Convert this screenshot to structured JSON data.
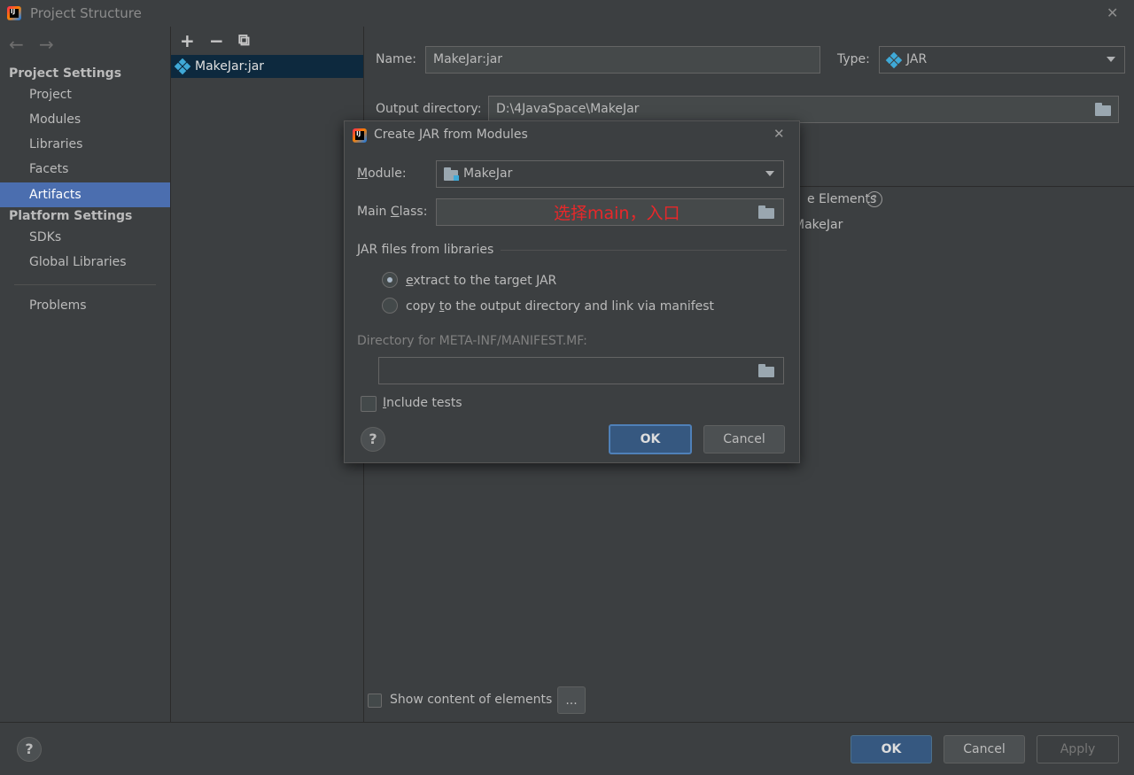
{
  "window": {
    "title": "Project Structure",
    "app_icon_text": "IJ",
    "close_glyph": "✕",
    "back_glyph": "←",
    "forward_glyph": "→"
  },
  "sidebar": {
    "project_settings_header": "Project Settings",
    "project_items": [
      {
        "label": "Project"
      },
      {
        "label": "Modules"
      },
      {
        "label": "Libraries"
      },
      {
        "label": "Facets"
      },
      {
        "label": "Artifacts",
        "selected": true
      }
    ],
    "platform_settings_header": "Platform Settings",
    "platform_items": [
      {
        "label": "SDKs"
      },
      {
        "label": "Global Libraries"
      }
    ],
    "problems_label": "Problems"
  },
  "artifacts_list": {
    "add_glyph": "+",
    "remove_glyph": "−",
    "copy_glyph": "⧉",
    "items": [
      {
        "label": "MakeJar:jar"
      }
    ]
  },
  "artifact_editor": {
    "name_label": "Name:",
    "name_value": "MakeJar:jar",
    "type_label": "Type:",
    "type_value": "JAR",
    "output_dir_label": "Output directory:",
    "output_dir_value": "D:\\4JavaSpace\\MakeJar",
    "available_elements_partial": "e Elements",
    "module_tree_partial": "MakeJar",
    "show_content_label": "Show content of elements",
    "ellipsis_button": "..."
  },
  "dialog": {
    "title": "Create JAR from Modules",
    "close_glyph": "✕",
    "module_label_u": "M",
    "module_label_rest": "odule:",
    "module_value": "MakeJar",
    "main_class_label_pre": "Main ",
    "main_class_label_u": "C",
    "main_class_label_post": "lass:",
    "main_class_annotation": "选择main，入口",
    "jar_files_section": "JAR files from libraries",
    "radio_extract_u": "e",
    "radio_extract_rest": "xtract to the target JAR",
    "radio_copy_pre": "copy ",
    "radio_copy_u": "t",
    "radio_copy_rest": "o the output directory and link via manifest",
    "manifest_dir_label": "Directory for META-INF/MANIFEST.MF:",
    "manifest_dir_value": "",
    "include_tests_u": "I",
    "include_tests_rest": "nclude tests",
    "help_glyph": "?",
    "ok_label": "OK",
    "cancel_label": "Cancel"
  },
  "footer": {
    "help_glyph": "?",
    "ok_label": "OK",
    "cancel_label": "Cancel",
    "apply_label": "Apply"
  },
  "colors": {
    "background": "#3c3f41",
    "selection": "#4b6eaf",
    "primary_button": "#365880",
    "annotation_red": "#e8282a"
  }
}
